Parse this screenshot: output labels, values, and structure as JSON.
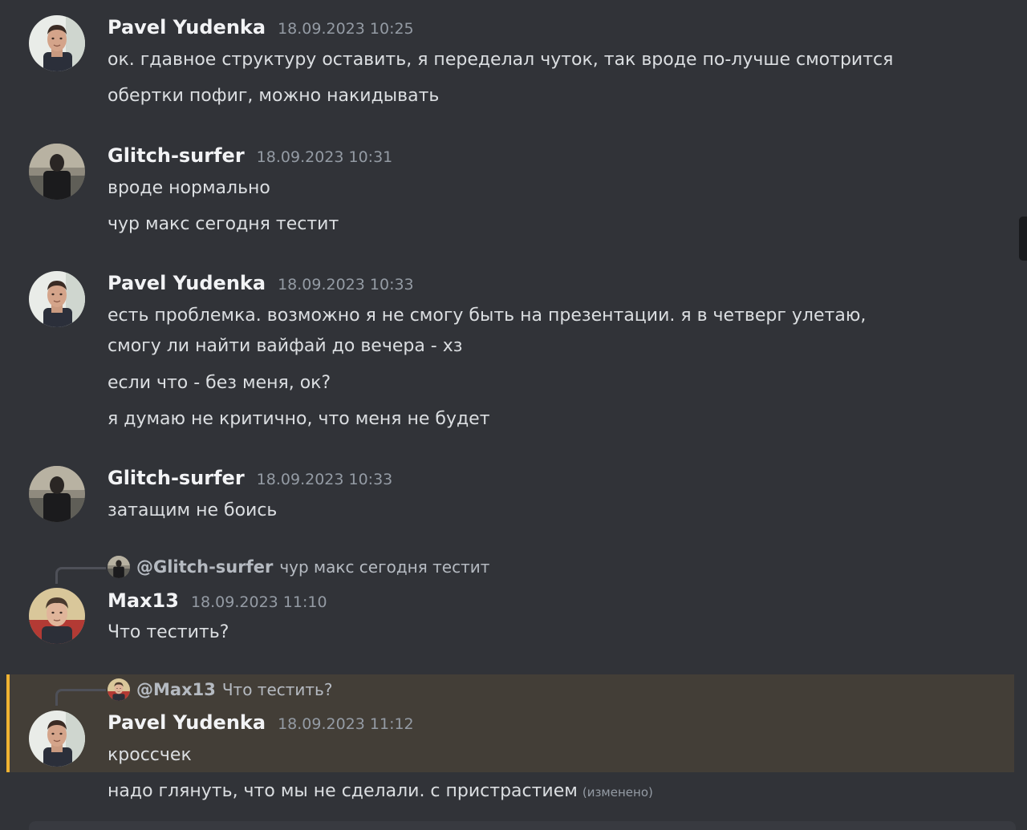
{
  "colors": {
    "background": "#313338",
    "mention_highlight": "#433e37",
    "mention_bar": "#f0b232",
    "username": "#f2f3f5",
    "message_text": "#dbdee1",
    "timestamp": "#949ba4"
  },
  "messages": [
    {
      "author": "Pavel Yudenka",
      "timestamp": "18.09.2023 10:25",
      "lines": [
        "ок. гдавное структуру оставить, я переделал чуток, так вроде по-лучше смотрится",
        "обертки пофиг, можно накидывать"
      ]
    },
    {
      "author": "Glitch-surfer",
      "timestamp": "18.09.2023 10:31",
      "lines": [
        "вроде нормально",
        "чур макс сегодня тестит"
      ]
    },
    {
      "author": "Pavel Yudenka",
      "timestamp": "18.09.2023 10:33",
      "lines": [
        "есть проблемка.  возможно я не смогу быть на презентации. я в четверг улетаю,",
        "смогу ли найти вайфай до вечера - хз",
        "если что - без меня, ок?",
        "я думаю не критично, что меня не будет"
      ]
    },
    {
      "author": "Glitch-surfer",
      "timestamp": "18.09.2023 10:33",
      "lines": [
        "затащим не боись"
      ]
    },
    {
      "reply": {
        "mention": "@Glitch-surfer",
        "text": "чур макс сегодня тестит"
      },
      "author": "Max13",
      "timestamp": "18.09.2023 11:10",
      "lines": [
        "Что тестить?"
      ]
    },
    {
      "reply": {
        "mention": "@Max13",
        "text": "Что тестить?"
      },
      "author": "Pavel Yudenka",
      "timestamp": "18.09.2023 11:12",
      "lines": [
        "кроссчек",
        "надо глянуть, что мы не сделали. с пристрастием"
      ],
      "edited_label": "(изменено)"
    }
  ]
}
